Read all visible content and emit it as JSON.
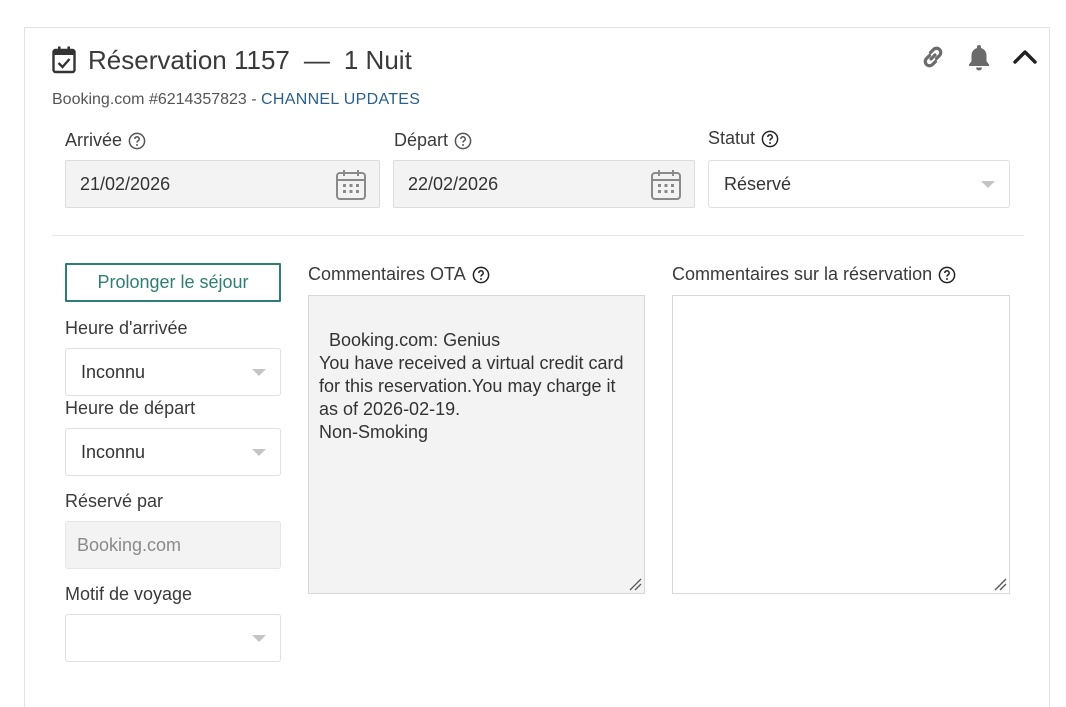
{
  "reservation": {
    "title_prefix": "Réservation 1157",
    "separator": "—",
    "nights": "1 Nuit",
    "source_line": "Booking.com #6214357823 -",
    "channel_updates": "CHANNEL UPDATES"
  },
  "header_icons": [
    "link-icon",
    "bell-icon",
    "chevron-up-icon"
  ],
  "dates": {
    "arrival_label": "Arrivée",
    "arrival_value": "21/02/2026",
    "departure_label": "Départ",
    "departure_value": "22/02/2026",
    "status_label": "Statut",
    "status_value": "Réservé"
  },
  "side": {
    "extend_button": "Prolonger le séjour",
    "arrival_time_label": "Heure d'arrivée",
    "arrival_time_value": "Inconnu",
    "departure_time_label": "Heure de départ",
    "departure_time_value": "Inconnu",
    "booked_by_label": "Réservé par",
    "booked_by_placeholder": "Booking.com",
    "travel_reason_label": "Motif de voyage",
    "travel_reason_value": ""
  },
  "comments": {
    "ota_label": "Commentaires OTA",
    "ota_text": "Booking.com: Genius\nYou have received a virtual credit card for this reservation.You may charge it as of 2026-02-19.\nNon-Smoking",
    "reservation_label": "Commentaires sur la réservation",
    "reservation_text": ""
  },
  "colors": {
    "accent": "#2f7d74",
    "link": "#2c5f8a",
    "icon": "#6b6b6b"
  }
}
